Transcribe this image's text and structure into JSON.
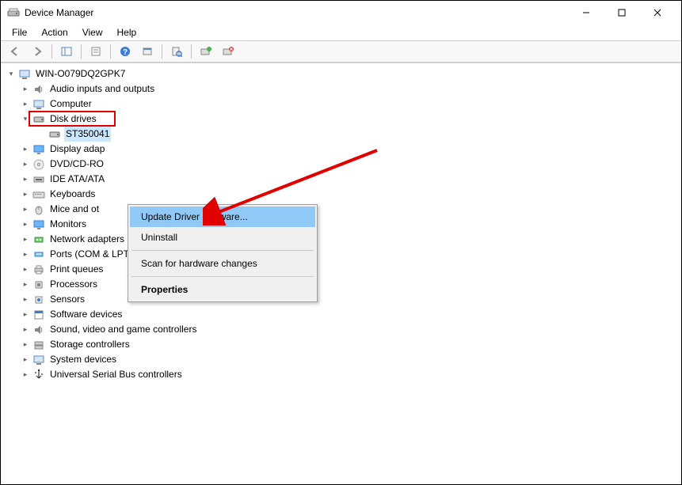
{
  "window": {
    "title": "Device Manager"
  },
  "menubar": {
    "file": "File",
    "action": "Action",
    "view": "View",
    "help": "Help"
  },
  "tree": {
    "root": "WIN-O079DQ2GPK7",
    "audio": "Audio inputs and outputs",
    "computer": "Computer",
    "disk_drives": "Disk drives",
    "disk_drive_item": "ST350041",
    "display_adapters": "Display adap",
    "dvd": "DVD/CD-RO",
    "ide": "IDE ATA/ATA",
    "keyboards": "Keyboards",
    "mice": "Mice and ot",
    "monitors": "Monitors",
    "network": "Network adapters",
    "ports": "Ports (COM & LPT)",
    "print_queues": "Print queues",
    "processors": "Processors",
    "sensors": "Sensors",
    "software_devices": "Software devices",
    "sound": "Sound, video and game controllers",
    "storage": "Storage controllers",
    "system_devices": "System devices",
    "usb": "Universal Serial Bus controllers"
  },
  "context_menu": {
    "update": "Update Driver Software...",
    "uninstall": "Uninstall",
    "scan": "Scan for hardware changes",
    "properties": "Properties"
  }
}
